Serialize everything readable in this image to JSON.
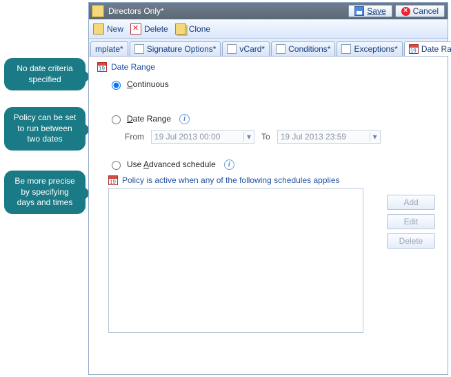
{
  "callouts": {
    "c1": "No date criteria specified",
    "c2": "Policy can be set to run between two dates",
    "c3": "Be more precise by specifying days and times"
  },
  "titlebar": {
    "title": "Directors Only*",
    "save": "Save",
    "cancel": "Cancel"
  },
  "toolbar": {
    "new_": "New",
    "delete_": "Delete",
    "clone": "Clone"
  },
  "tabs": {
    "t0": "mplate*",
    "t1": "Signature Options*",
    "t2": "vCard*",
    "t3": "Conditions*",
    "t4": "Exceptions*",
    "t5": "Date Range"
  },
  "section": {
    "title": "Date Range"
  },
  "options": {
    "continuous_pre": "C",
    "continuous_rest": "ontinuous",
    "daterange_pre": "D",
    "daterange_rest": "ate Range",
    "advanced_pre": "Use ",
    "advanced_u": "A",
    "advanced_rest": "dvanced schedule"
  },
  "dates": {
    "from_label": "From",
    "from_value": "19 Jul 2013 00:00",
    "to_label": "To",
    "to_value": "19 Jul 2013 23:59"
  },
  "schedule_desc": "Policy is active when any of the following schedules applies",
  "buttons": {
    "add": "Add",
    "edit": "Edit",
    "del": "Delete"
  }
}
